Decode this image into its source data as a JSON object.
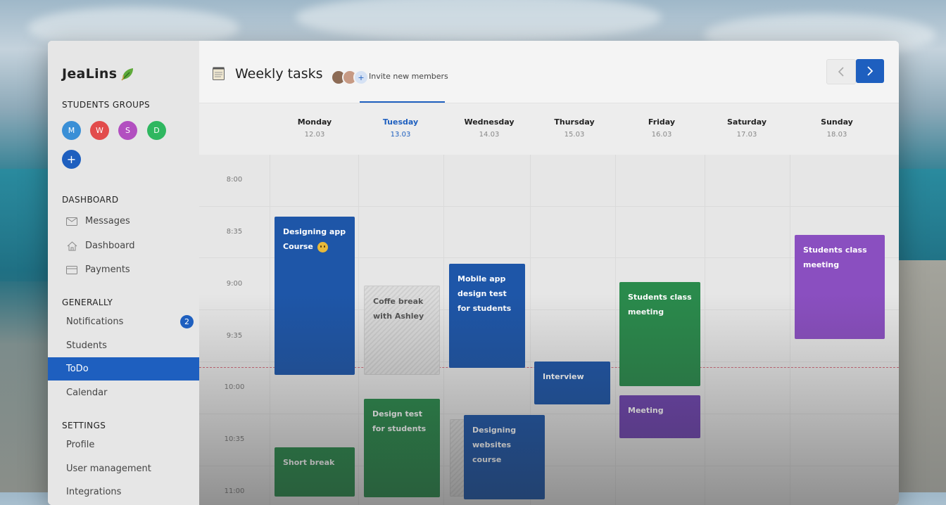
{
  "app": {
    "brand": "JeaLins",
    "accent": "#1e5fbf"
  },
  "sidebar": {
    "groups_title": "STUDENTS GROUPS",
    "groups": [
      {
        "letter": "M",
        "color": "#3a8fd6"
      },
      {
        "letter": "W",
        "color": "#e24c4c"
      },
      {
        "letter": "S",
        "color": "#b24fc0"
      },
      {
        "letter": "D",
        "color": "#2fb760"
      }
    ],
    "add_group": "+",
    "dashboard_title": "DASHBOARD",
    "dashboard_items": [
      {
        "label": "Messages",
        "icon": "mail-icon"
      },
      {
        "label": "Dashboard",
        "icon": "home-icon"
      },
      {
        "label": "Payments",
        "icon": "card-icon"
      }
    ],
    "generally_title": "GENERALLY",
    "generally_items": [
      {
        "label": "Notifications",
        "badge": "2"
      },
      {
        "label": "Students"
      },
      {
        "label": "ToDo",
        "active": true
      },
      {
        "label": "Calendar"
      }
    ],
    "settings_title": "SETTINGS",
    "settings_items": [
      {
        "label": "Profile"
      },
      {
        "label": "User management"
      },
      {
        "label": "Integrations"
      }
    ]
  },
  "header": {
    "title": "Weekly tasks",
    "invite": "Invite new members",
    "invite_plus": "+"
  },
  "days": [
    {
      "name": "Monday",
      "date": "12.03"
    },
    {
      "name": "Tuesday",
      "date": "13.03",
      "selected": true
    },
    {
      "name": "Wednesday",
      "date": "14.03"
    },
    {
      "name": "Thursday",
      "date": "15.03"
    },
    {
      "name": "Friday",
      "date": "16.03"
    },
    {
      "name": "Saturday",
      "date": "17.03"
    },
    {
      "name": "Sunday",
      "date": "18.03"
    }
  ],
  "times": [
    "8:00",
    "8:35",
    "9:00",
    "9:35",
    "10:00",
    "10:35",
    "11:00"
  ],
  "events": {
    "e1": "Designing app Course",
    "e2": "Coffe break with Ashley",
    "e3": "Mobile app design test for students",
    "e4": "Interview",
    "e5": "Students class meeting",
    "e6": "Meeting",
    "e7": "Students class meeting",
    "e8": "Design test for students",
    "e9": "Designing websites course",
    "e10": "Short break"
  }
}
